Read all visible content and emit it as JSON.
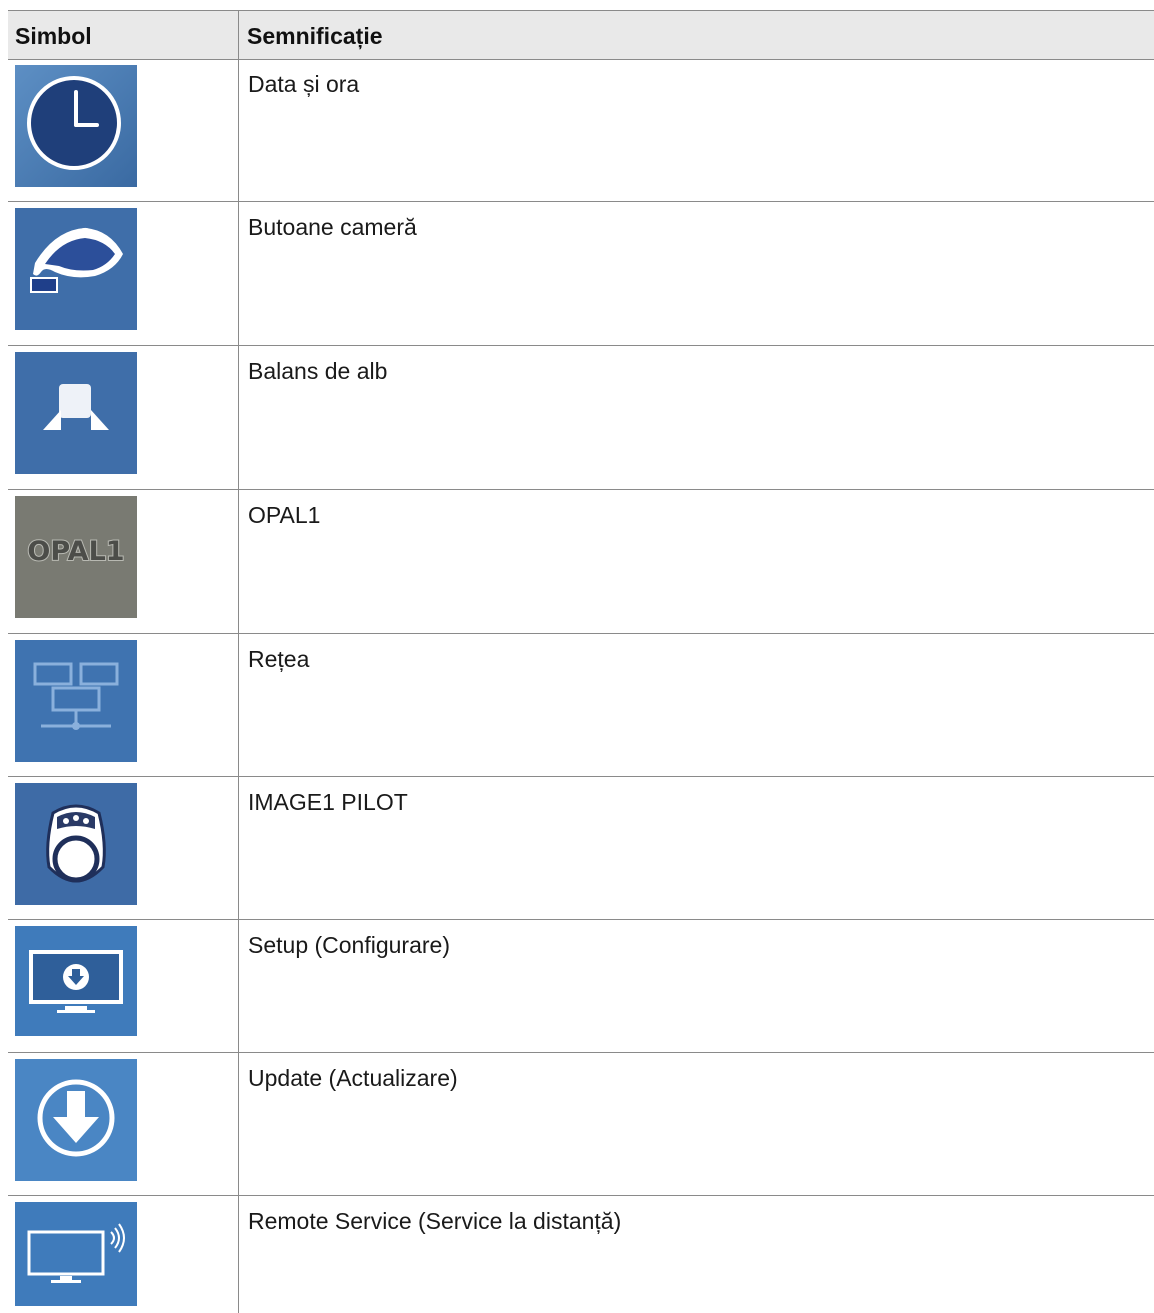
{
  "header": {
    "col_symbol": "Simbol",
    "col_meaning": "Semnificație"
  },
  "rows": [
    {
      "icon": "clock-icon",
      "label": "Data și ora"
    },
    {
      "icon": "hand-press-icon",
      "label": "Butoane cameră"
    },
    {
      "icon": "white-balance-icon",
      "label": "Balans de alb"
    },
    {
      "icon": "opal1-icon",
      "label": "OPAL1",
      "icon_text": "OPAL1"
    },
    {
      "icon": "network-icon",
      "label": "Rețea"
    },
    {
      "icon": "image1-pilot-icon",
      "label": "IMAGE1 PILOT"
    },
    {
      "icon": "setup-monitor-icon",
      "label": "Setup (Configurare)"
    },
    {
      "icon": "update-download-icon",
      "label": "Update (Actualizare)"
    },
    {
      "icon": "remote-service-icon",
      "label": "Remote Service (Service la distanță)"
    }
  ],
  "colors": {
    "icon_blue": "#3d6fa8",
    "icon_gray": "#797a72",
    "header_bg": "#e9e9e9",
    "border": "#8a8a8a"
  }
}
